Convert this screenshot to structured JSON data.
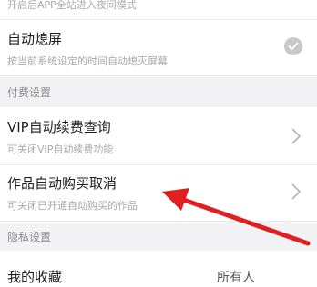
{
  "top_partial": {
    "subtitle": "开启后APP全站进入夜间模式"
  },
  "auto_screen_off": {
    "title": "自动熄屏",
    "subtitle": "按当前系统设定的时间自动熄灭屏幕",
    "checked": true
  },
  "section_paid": {
    "label": "付费设置"
  },
  "vip_renewal": {
    "title": "VIP自动续费查询",
    "subtitle": "可关闭VIP自动续费功能"
  },
  "auto_purchase": {
    "title": "作品自动购买取消",
    "subtitle": "可关闭已开通自动购买的作品"
  },
  "section_privacy": {
    "label": "隐私设置"
  },
  "my_favorites": {
    "title": "我的收藏",
    "value": "所有人"
  },
  "colors": {
    "annotation_arrow": "#e02020",
    "check_bg": "#c8c8c8"
  },
  "icons": {
    "chevron": "chevron-right-icon",
    "check": "check-icon"
  }
}
